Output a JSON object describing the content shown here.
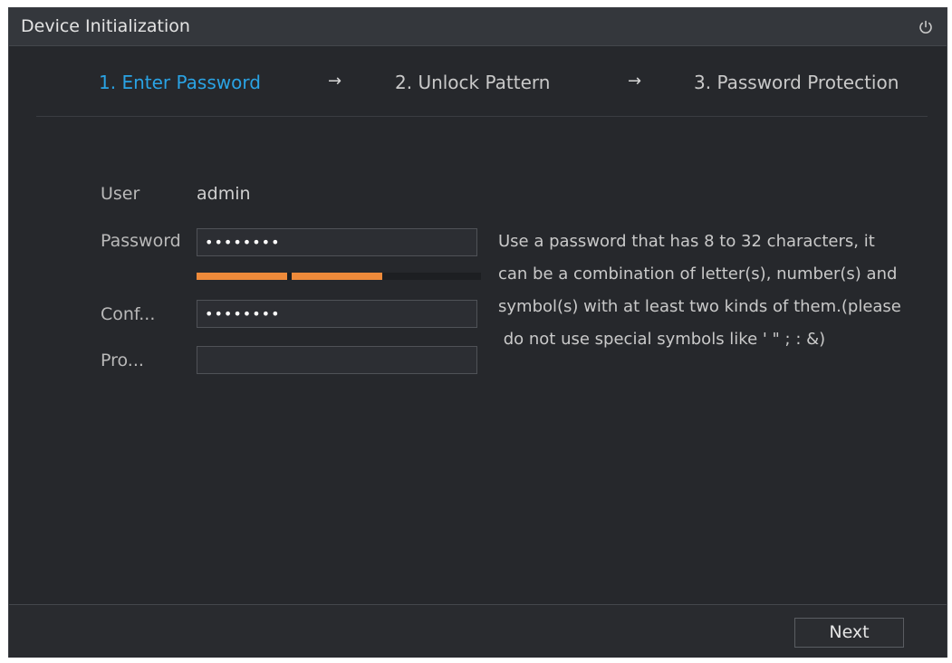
{
  "window": {
    "title": "Device Initialization",
    "power_icon": "power-icon"
  },
  "steps": [
    {
      "label": "1.  Enter Password",
      "active": true
    },
    {
      "label": "2.  Unlock Pattern",
      "active": false
    },
    {
      "label": "3.  Password Protection",
      "active": false
    }
  ],
  "step_arrow": "→",
  "form": {
    "user_label": "User",
    "user_value": "admin",
    "password_label": "Password",
    "password_value": "••••••••",
    "password_strength_segments_filled": 2,
    "confirm_label": "Conf...",
    "confirm_value": "••••••••",
    "prompt_label": "Pro...",
    "prompt_value": ""
  },
  "hint": {
    "lines": [
      "Use a password that has 8 to 32 characters, it",
      "can be a combination of letter(s), number(s) and",
      "symbol(s) with at least two kinds of them.(please",
      " do not use special symbols like ' \" ; : &)"
    ]
  },
  "footer": {
    "next_label": "Next"
  },
  "colors": {
    "active_step": "#2aa3e4",
    "strength_bar": "#ee8a3a",
    "background": "#26282c"
  }
}
